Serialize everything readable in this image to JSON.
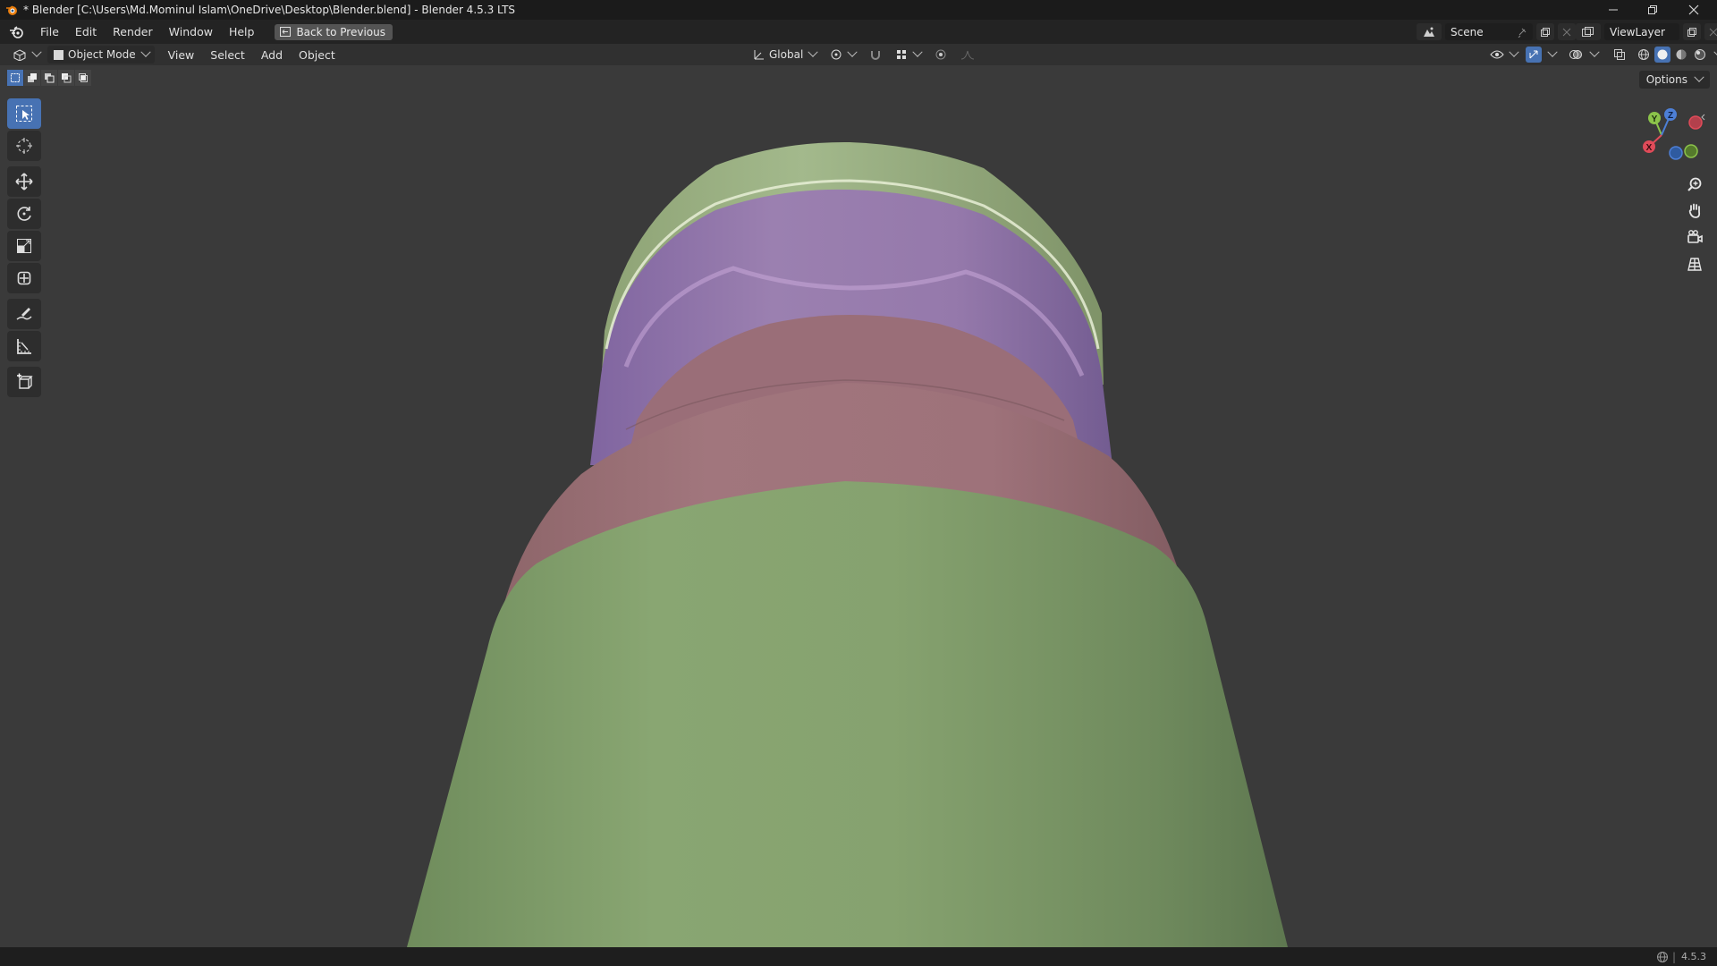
{
  "window": {
    "title": "* Blender [C:\\Users\\Md.Mominul Islam\\OneDrive\\Desktop\\Blender.blend] - Blender 4.5.3 LTS"
  },
  "menu": {
    "items": [
      "File",
      "Edit",
      "Render",
      "Window",
      "Help"
    ],
    "back_button": "Back to Previous"
  },
  "scene": {
    "name": "Scene"
  },
  "view_layer": {
    "name": "ViewLayer"
  },
  "viewport_header": {
    "mode": "Object Mode",
    "menus": [
      "View",
      "Select",
      "Add",
      "Object"
    ],
    "transform_orientation": "Global",
    "options_label": "Options"
  },
  "gizmo": {
    "y": "Y",
    "z": "Z",
    "x": "X"
  },
  "status": {
    "version": "4.5.3"
  },
  "colors": {
    "accent": "#4772b3",
    "object_green": "#86a26f",
    "object_pink": "#9e727a",
    "object_purple": "#9579ab"
  }
}
